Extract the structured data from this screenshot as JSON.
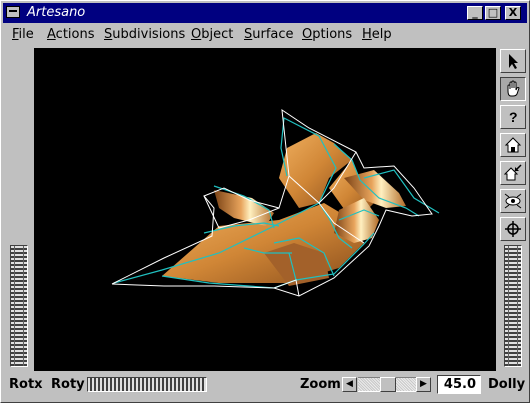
{
  "window": {
    "title": "Artesano"
  },
  "title_buttons": {
    "minimize": "_",
    "maximize": "□",
    "close": "X"
  },
  "menu": [
    {
      "label": "File",
      "key": "F",
      "rest": "ile"
    },
    {
      "label": "Actions",
      "key": "A",
      "rest": "ctions"
    },
    {
      "label": "Subdivisions",
      "key": "S",
      "rest": "ubdivisions"
    },
    {
      "label": "Object",
      "key": "O",
      "rest": "bject"
    },
    {
      "label": "Surface",
      "key": "S",
      "rest": "urface"
    },
    {
      "label": "Options",
      "key": "O",
      "rest": "ptions"
    },
    {
      "label": "Help",
      "key": "H",
      "rest": "elp"
    }
  ],
  "tools": [
    {
      "name": "select-arrow-icon",
      "active": false
    },
    {
      "name": "hand-icon",
      "active": true
    },
    {
      "name": "question-icon",
      "active": false
    },
    {
      "name": "home-icon",
      "active": false
    },
    {
      "name": "set-home-icon",
      "active": false
    },
    {
      "name": "view-all-icon",
      "active": false
    },
    {
      "name": "seek-crosshair-icon",
      "active": false
    }
  ],
  "bottom": {
    "rotx_label": "Rotx",
    "roty_label": "Roty",
    "zoom_label": "Zoom",
    "zoom_left_arrow": "◀",
    "zoom_right_arrow": "▶",
    "zoom_value": "45.0",
    "dolly_label": "Dolly"
  },
  "colors": {
    "titlebar": "#000080",
    "viewport_bg": "#000000",
    "surface": "#d58a3a",
    "cage_lines": "#ffffff",
    "edge_lines": "#20c0c0"
  }
}
